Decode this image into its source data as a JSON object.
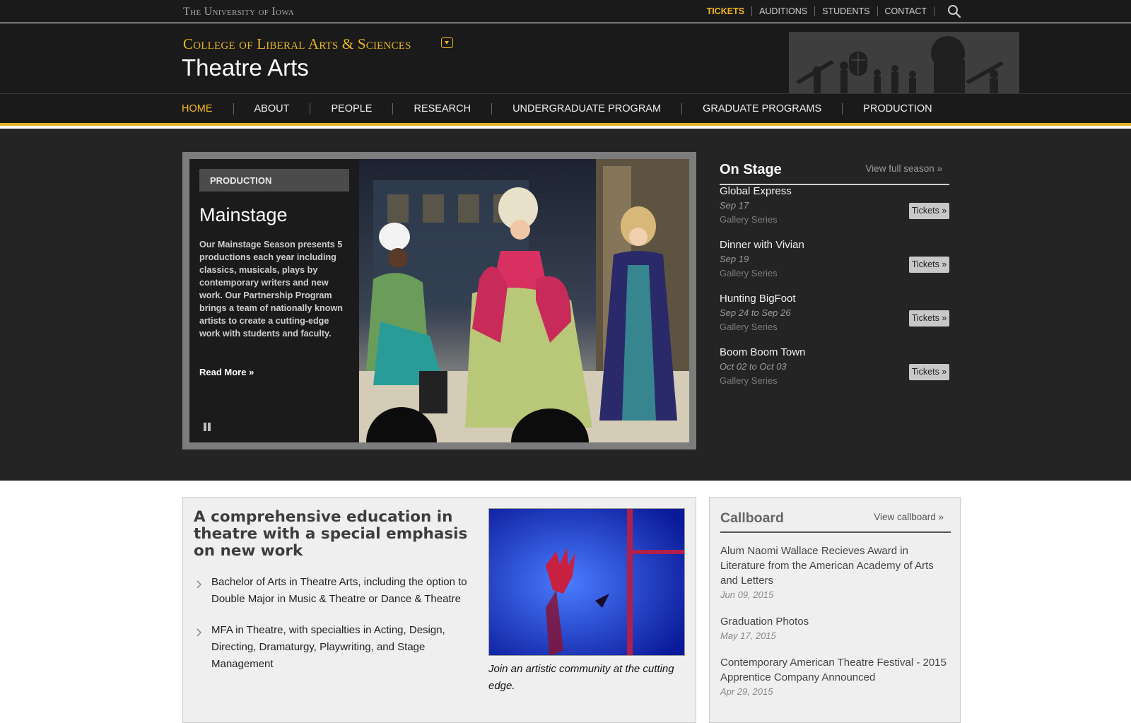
{
  "topbar": {
    "university": "The University of Iowa",
    "links": [
      {
        "label": "TICKETS",
        "active": true
      },
      {
        "label": "AUDITIONS",
        "active": false
      },
      {
        "label": "STUDENTS",
        "active": false
      },
      {
        "label": "CONTACT",
        "active": false
      }
    ],
    "search_icon": "search-icon"
  },
  "header": {
    "college": "College of Liberal Arts & Sciences",
    "department": "Theatre Arts",
    "toggle_icon": "chevron-down-icon"
  },
  "nav": {
    "items": [
      {
        "label": "HOME",
        "active": true
      },
      {
        "label": "ABOUT",
        "active": false
      },
      {
        "label": "PEOPLE",
        "active": false
      },
      {
        "label": "RESEARCH",
        "active": false
      },
      {
        "label": "UNDERGRADUATE PROGRAM",
        "active": false
      },
      {
        "label": "GRADUATE PROGRAMS",
        "active": false
      },
      {
        "label": "PRODUCTION",
        "active": false
      }
    ]
  },
  "slider": {
    "tag": "PRODUCTION",
    "title": "Mainstage",
    "description": "Our Mainstage Season presents 5 productions each year including classics, musicals, plays by contemporary writers and new work. Our Partnership Program brings a team of nationally known artists to create a cutting-edge work with students and faculty.",
    "read_more": "Read More »",
    "pause_icon": "pause-icon"
  },
  "onstage": {
    "title": "On Stage",
    "view_all": "View full season »",
    "items": [
      {
        "name": "Global Express",
        "date": "Sep 17",
        "series": "Gallery Series",
        "ticket": "Tickets »"
      },
      {
        "name": "Dinner with Vivian",
        "date": "Sep 19",
        "series": "Gallery Series",
        "ticket": "Tickets »"
      },
      {
        "name": "Hunting BigFoot",
        "date": "Sep 24 to Sep 26",
        "series": "Gallery Series",
        "ticket": "Tickets »"
      },
      {
        "name": "Boom Boom Town",
        "date": "Oct 02 to Oct 03",
        "series": "Gallery Series",
        "ticket": "Tickets »"
      }
    ]
  },
  "education": {
    "title": "A comprehensive education in theatre with a special emphasis on new work",
    "items": [
      "Bachelor of Arts in Theatre Arts, including the option to Double Major in Music & Theatre or Dance & Theatre",
      "MFA in Theatre, with specialties in Acting, Design, Directing, Dramaturgy, Playwriting, and Stage Management"
    ],
    "caption": "Join an artistic community at the cutting edge."
  },
  "callboard": {
    "title": "Callboard",
    "view_all": "View callboard »",
    "items": [
      {
        "text": "Alum Naomi Wallace Recieves Award in Literature from the American Academy of Arts and Letters",
        "date": "Jun 09, 2015"
      },
      {
        "text": "Graduation Photos",
        "date": "May 17, 2015"
      },
      {
        "text": "Contemporary American Theatre Festival - 2015 Apprentice Company Announced",
        "date": "Apr 29, 2015"
      }
    ]
  },
  "colors": {
    "gold": "#e6b527",
    "dark": "#1a1a1a",
    "feature_bg": "#252425"
  }
}
